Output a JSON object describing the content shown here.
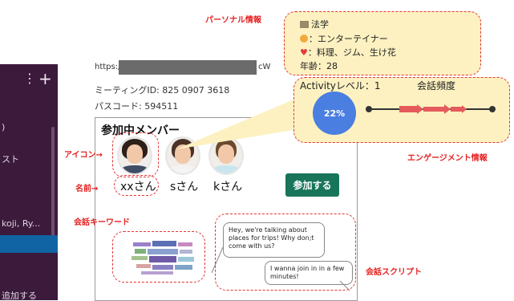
{
  "sidebar": {
    "dots_glyph": "⋮",
    "plus_glyph": "+",
    "fragments": [
      ")",
      "スト",
      "koji, Ry...",
      "追加する"
    ]
  },
  "meeting": {
    "url_prefix": "https://",
    "url_suffix": "cW",
    "id_text": "ミーティングID: 825 0907 3618",
    "passcode_text": "パスコード: 594511"
  },
  "panel": {
    "title": "参加中メンバー",
    "members": [
      {
        "name": "xxさん"
      },
      {
        "name": "sさん"
      },
      {
        "name": "kさん"
      }
    ],
    "join_label": "参加する"
  },
  "chat": {
    "bubble1": "Hey, we're talking about places for trips! Why don;t come with us?",
    "bubble2": "I wanna join in in a few minutes!"
  },
  "personal_info": {
    "major": "法学",
    "hobby_like": "：エンターテイナー",
    "hobby_heart": "：料理、ジム、生け花",
    "age": "年齢：28"
  },
  "engagement": {
    "activity_label": "Activityレベル：1",
    "frequency_label": "会話頻度",
    "percent_label": "22%"
  },
  "annotations": {
    "personal": "パーソナル情報",
    "icon": "アイコン→",
    "name": "名前→",
    "keyword": "会話キーワード",
    "engagement": "エンゲージメント情報",
    "script": "会話スクリプト"
  },
  "colors": {
    "accent_red": "#e52222",
    "join_green": "#18755a",
    "callout_fill": "#fdf1c1",
    "pie_blue": "#4a7ee0",
    "sidebar_bg": "#3b1a3c"
  },
  "icons": [
    "building-icon",
    "person-icon",
    "heart-icon",
    "more-vertical-icon",
    "plus-icon"
  ]
}
